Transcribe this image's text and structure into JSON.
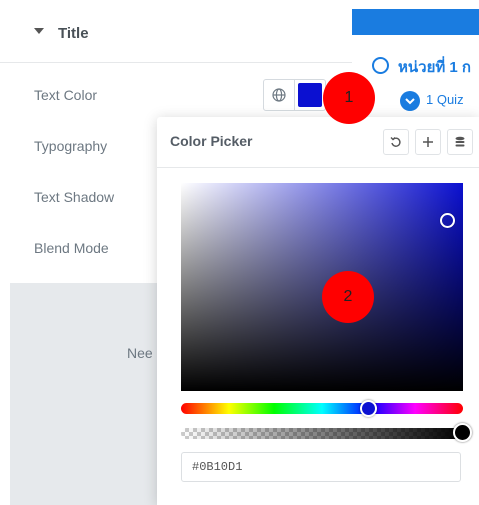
{
  "section": {
    "title": "Title"
  },
  "controls": [
    {
      "label": "Text Color"
    },
    {
      "label": "Typography"
    },
    {
      "label": "Text Shadow"
    },
    {
      "label": "Blend Mode"
    }
  ],
  "current_color": "#0B10D1",
  "hidden_text": "Nee",
  "right_panel": {
    "lesson_title": "หน่วยที่ 1 ก",
    "quiz_label": "1 Quiz",
    "accent": "#1a7ce0"
  },
  "picker": {
    "title": "Color Picker",
    "hex_value": "#0B10D1",
    "tools": [
      "reset-icon",
      "plus-icon",
      "database-icon"
    ]
  },
  "badges": [
    "1",
    "2"
  ],
  "colors": {
    "badge": "#ff0000",
    "label_text": "#6d7882"
  }
}
